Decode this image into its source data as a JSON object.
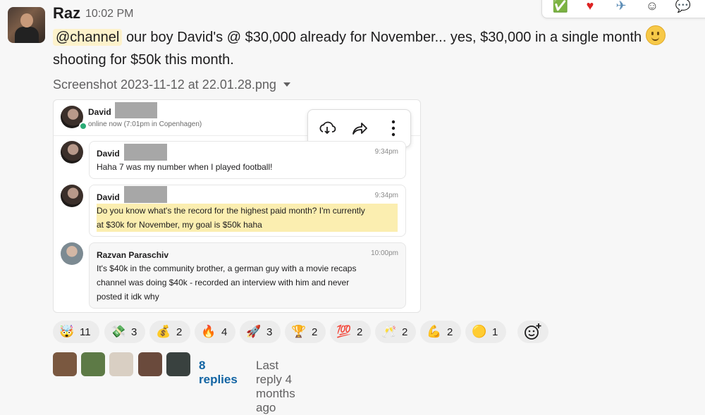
{
  "message": {
    "author": "Raz",
    "time": "10:02 PM",
    "mention": "@channel",
    "text_line1": "our boy David's @ $30,000 already for November... yes, $30,000 in a single month",
    "text_line2": "shooting for $50k this month.",
    "attachment_name": "Screenshot 2023-11-12 at 22.01.28.png"
  },
  "screenshot": {
    "header_name": "David",
    "header_status": "online now (7:01pm in Copenhagen)",
    "cards": [
      {
        "name": "David",
        "time": "9:34pm",
        "lines": [
          "Haha 7 was my number when I played football!"
        ]
      },
      {
        "name": "David",
        "time": "9:34pm",
        "lines": [
          "Do you know what's the record for the highest paid month? I'm currently",
          "at $30k for November, my goal is $50k haha"
        ]
      },
      {
        "name": "Razvan Paraschiv",
        "time": "10:00pm",
        "lines": [
          "It's $40k in the community brother, a german guy with a movie recaps",
          "channel was doing $40k - recorded an interview with him and never",
          "posted it idk why"
        ]
      }
    ]
  },
  "reactions": [
    {
      "emoji": "🤯",
      "count": "11"
    },
    {
      "emoji": "💸",
      "count": "3"
    },
    {
      "emoji": "💰",
      "count": "2"
    },
    {
      "emoji": "🔥",
      "count": "4"
    },
    {
      "emoji": "🚀",
      "count": "3"
    },
    {
      "emoji": "🏆",
      "count": "2"
    },
    {
      "emoji": "💯",
      "count": "2"
    },
    {
      "emoji": "🥂",
      "count": "2"
    },
    {
      "emoji": "💪",
      "count": "2"
    },
    {
      "emoji": "🟡",
      "count": "1"
    }
  ],
  "thread": {
    "replies": "8 replies",
    "last_reply": "Last reply 4 months ago"
  }
}
